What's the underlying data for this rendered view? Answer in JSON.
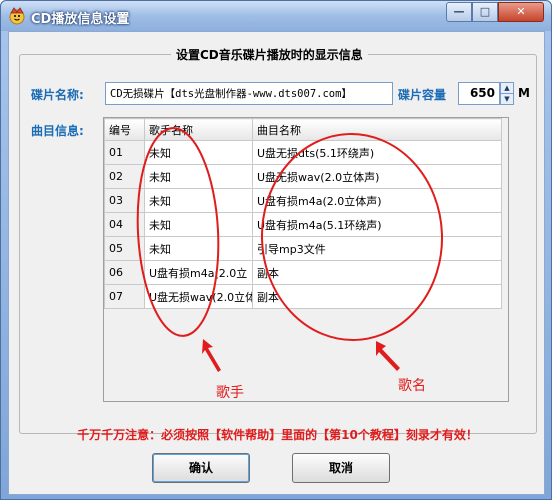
{
  "window": {
    "title": "CD播放信息设置",
    "buttons": {
      "minimize": "—",
      "maximize": "□",
      "close": "✕"
    }
  },
  "group": {
    "title": "设置CD音乐碟片播放时的显示信息"
  },
  "disc": {
    "name_label": "碟片名称:",
    "name_value": "CD无损碟片【dts光盘制作器-www.dts007.com】",
    "capacity_label": "碟片容量",
    "capacity_value": "650",
    "capacity_unit": "M"
  },
  "tracks": {
    "label": "曲目信息:",
    "columns": [
      "编号",
      "歌手名称",
      "曲目名称"
    ],
    "rows": [
      [
        "01",
        "未知",
        "U盘无损dts(5.1环绕声)"
      ],
      [
        "02",
        "未知",
        "U盘无损wav(2.0立体声)"
      ],
      [
        "03",
        "未知",
        "U盘有损m4a(2.0立体声)"
      ],
      [
        "04",
        "未知",
        "U盘有损m4a(5.1环绕声)"
      ],
      [
        "05",
        "未知",
        "引导mp3文件"
      ],
      [
        "06",
        "U盘有损m4a(2.0立",
        "副本"
      ],
      [
        "07",
        "U盘无损wav(2.0立体",
        "副本"
      ]
    ]
  },
  "warning": "千万千万注意：必须按照【软件帮助】里面的【第10个教程】刻录才有效！",
  "actions": {
    "ok": "确认",
    "cancel": "取消"
  },
  "annotations": {
    "singer": "歌手",
    "song": "歌名",
    "color": "#e01c1c"
  }
}
